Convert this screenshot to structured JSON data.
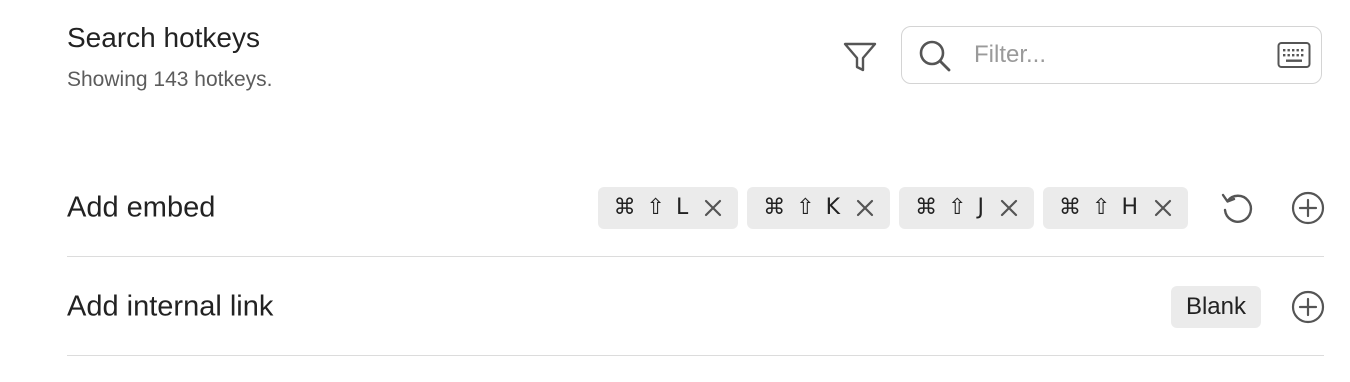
{
  "header": {
    "title": "Search hotkeys",
    "subtitle": "Showing 143 hotkeys.",
    "filter_icon": "filter-icon",
    "search": {
      "placeholder": "Filter...",
      "value": "",
      "icon": "search-icon",
      "keyboard_icon": "keyboard-icon"
    }
  },
  "hotkeys": [
    {
      "label": "Add embed",
      "bindings": [
        {
          "keys": "⌘ ⇧ L"
        },
        {
          "keys": "⌘ ⇧ K"
        },
        {
          "keys": "⌘ ⇧ J"
        },
        {
          "keys": "⌘ ⇧ H"
        }
      ],
      "has_reset": true
    },
    {
      "label": "Add internal link",
      "blank_label": "Blank",
      "bindings": [],
      "has_reset": false
    }
  ],
  "colors": {
    "chip_bg": "#ebebeb",
    "divider": "#dcdcdc",
    "muted_text": "#5c5c5c",
    "icon": "#555555"
  }
}
